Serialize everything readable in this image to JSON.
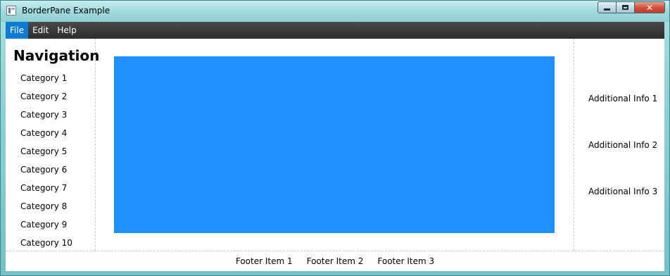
{
  "window": {
    "title": "BorderPane Example",
    "minimize_icon": "minimize-icon",
    "maximize_icon": "maximize-icon",
    "close_icon": "close-icon",
    "close_glyph": "✕"
  },
  "menubar": {
    "items": [
      {
        "label": "File",
        "active": true
      },
      {
        "label": "Edit",
        "active": false
      },
      {
        "label": "Help",
        "active": false
      }
    ],
    "active_color": "#0b7bd4"
  },
  "left": {
    "title": "Navigation",
    "links": [
      "Category 1",
      "Category 2",
      "Category 3",
      "Category 4",
      "Category 5",
      "Category 6",
      "Category 7",
      "Category 8",
      "Category 9",
      "Category 10"
    ]
  },
  "center": {
    "rect_color": "#1e90ff"
  },
  "right": {
    "labels": [
      "Additional Info 1",
      "Additional Info 2",
      "Additional Info 3"
    ]
  },
  "footer": {
    "items": [
      "Footer Item 1",
      "Footer Item 2",
      "Footer Item 3"
    ]
  }
}
